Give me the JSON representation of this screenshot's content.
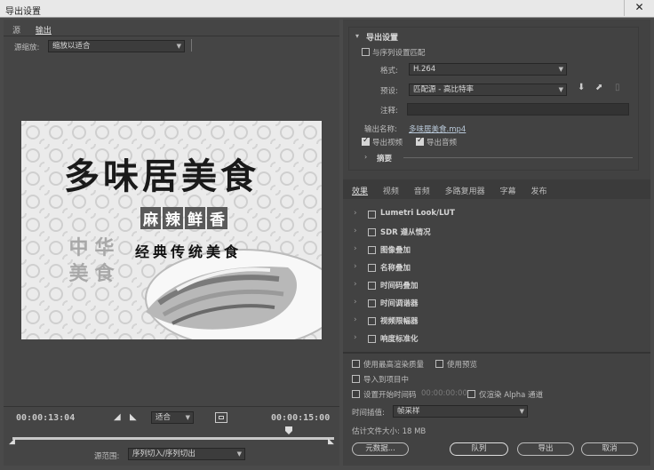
{
  "window": {
    "title": "导出设置",
    "close": "✕"
  },
  "source_panel": {
    "tabs": [
      "源",
      "输出"
    ],
    "scale_label": "源缩放:",
    "scale_value": "缩放以适合"
  },
  "preview": {
    "title": "多味居美食",
    "subtitle_chars": [
      "麻",
      "辣",
      "鲜",
      "香"
    ],
    "tagline": "经典传统美食",
    "seal_chars": [
      "中",
      "华",
      "美",
      "食"
    ]
  },
  "timeline": {
    "start_time": "00:00:13:04",
    "end_time": "00:00:15:00",
    "fit_value": "适合",
    "range_label": "源范围:",
    "range_value": "序列切入/序列切出"
  },
  "export_settings": {
    "section_title": "导出设置",
    "match_sequence": "与序列设置匹配",
    "format_label": "格式:",
    "format_value": "H.264",
    "preset_label": "预设:",
    "preset_value": "匹配源 - 高比特率",
    "comments_label": "注释:",
    "output_name_label": "输出名称:",
    "output_name_value": "多味居美食.mp4",
    "export_video": "导出视频",
    "export_audio": "导出音频",
    "summary": "摘要"
  },
  "effect_tabs": [
    "效果",
    "视频",
    "音频",
    "多路复用器",
    "字幕",
    "发布"
  ],
  "effects": [
    "Lumetri Look/LUT",
    "SDR 遵从情况",
    "图像叠加",
    "名称叠加",
    "时间码叠加",
    "时间调谐器",
    "视频限幅器",
    "响度标准化"
  ],
  "bottom": {
    "max_quality": "使用最高渲染质量",
    "use_preview": "使用预览",
    "import_project": "导入到项目中",
    "set_start_timecode": "设置开始时间码",
    "start_timecode_value": "00:00:00:00",
    "alpha_only": "仅渲染 Alpha 通道",
    "interp_label": "时间插值:",
    "interp_value": "帧采样",
    "filesize": "估计文件大小:  18 MB",
    "metadata_btn": "元数据...",
    "queue_btn": "队列",
    "export_btn": "导出",
    "cancel_btn": "取消"
  }
}
